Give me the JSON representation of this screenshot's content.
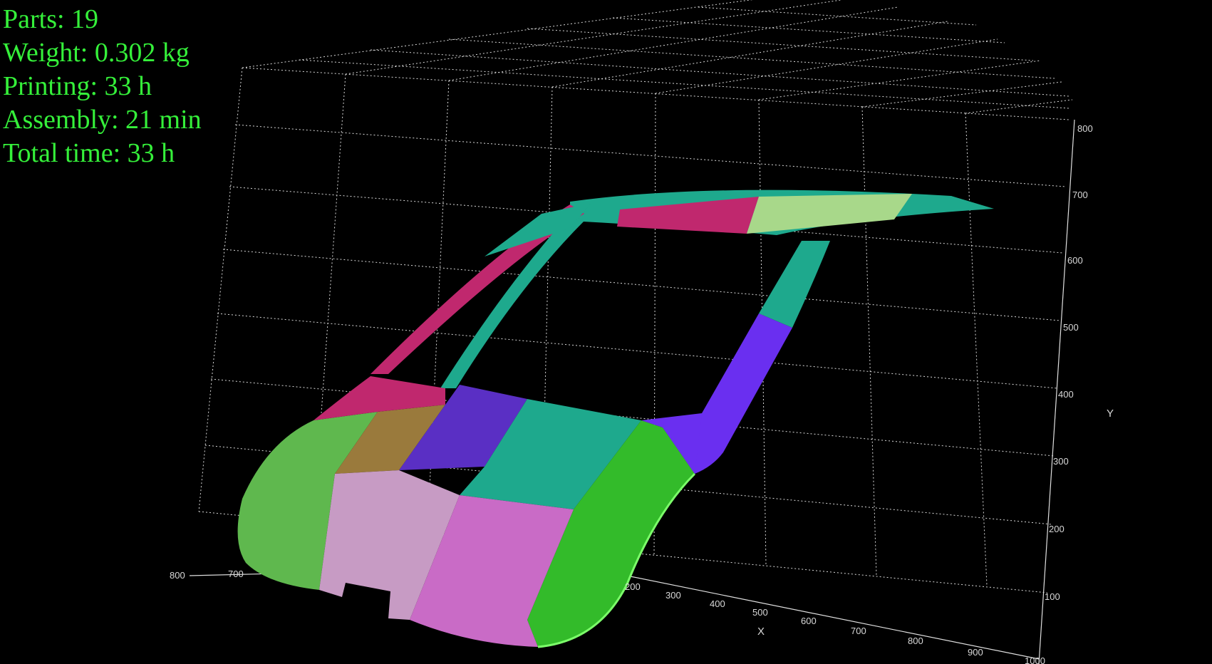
{
  "stats": {
    "parts": "Parts: 19",
    "weight": "Weight: 0.302 kg",
    "printing": "Printing: 33 h",
    "assembly": "Assembly: 21 min",
    "total_time": "Total time: 33 h"
  },
  "axes": {
    "x_title": "X",
    "y_title": "Y",
    "x_ticks": [
      "200",
      "300",
      "400",
      "500",
      "600",
      "700",
      "800",
      "900",
      "1000"
    ],
    "y_ticks": [
      "100",
      "200",
      "300",
      "400",
      "500",
      "600",
      "700",
      "800"
    ],
    "z_ticks": [
      "800",
      "700"
    ]
  },
  "colors": {
    "stats_text": "#35f03a",
    "grid": "#d8d8d8",
    "green": "#5fb84e",
    "bright_green": "#33bb2a",
    "brown": "#9a7a3c",
    "purple": "#5a2fc4",
    "violet": "#6a2ff0",
    "teal": "#1ea98d",
    "light_pink": "#c79bc4",
    "pink": "#c96bc6",
    "magenta": "#c0286e",
    "pale_green": "#a8d88a"
  }
}
